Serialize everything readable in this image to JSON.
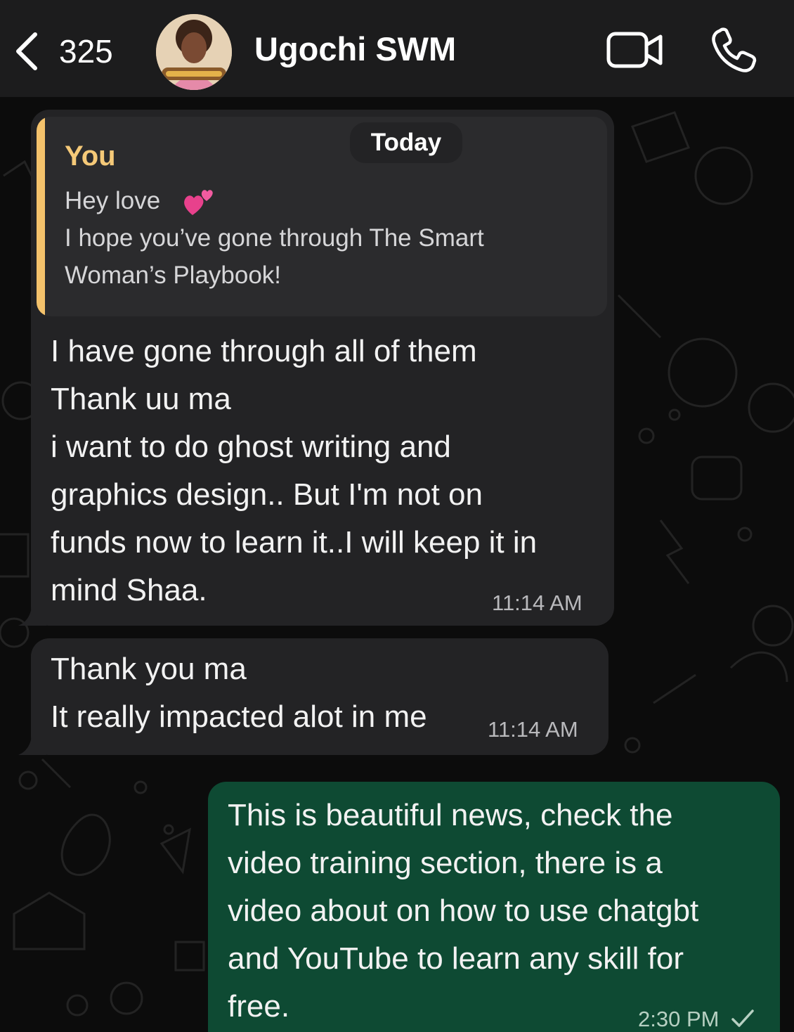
{
  "header": {
    "back_count": "325",
    "contact_name": "Ugochi SWM"
  },
  "date_separator": "Today",
  "messages": [
    {
      "direction": "incoming",
      "reply_to": {
        "author": "You",
        "line1": "Hey love",
        "line2": "I hope you’ve gone through The Smart\nWoman’s Playbook!"
      },
      "text": "I have gone through all of them\nThank uu ma\ni want to do ghost writing and\ngraphics design.. But I'm not on\nfunds now to learn it..I will keep it in\nmind Shaa.",
      "time": "11:14 AM"
    },
    {
      "direction": "incoming",
      "text": "Thank you ma\nIt really impacted alot in me",
      "time": "11:14 AM"
    },
    {
      "direction": "outgoing",
      "text": "This is beautiful news, check the\nvideo training section, there is a\nvideo about on how to use chatgbt\nand YouTube to learn any skill for\nfree.",
      "time": "2:30 PM",
      "status": "sent-check"
    }
  ],
  "icons": {
    "back": "chevron-left-icon",
    "video": "video-camera-icon",
    "call": "phone-icon",
    "reaction": "two-hearts-emoji",
    "status": "checkmark-icon"
  },
  "colors": {
    "header_bg": "#1c1c1d",
    "incoming_bubble": "#232325",
    "outgoing_bubble": "#0e4a33",
    "quote_accent": "#f4c26b"
  }
}
